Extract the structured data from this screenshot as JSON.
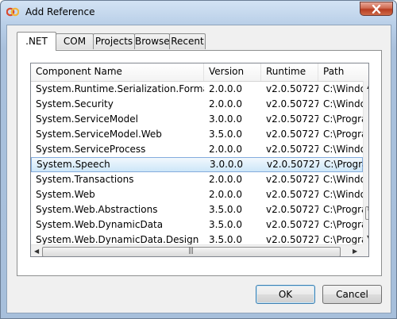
{
  "window": {
    "title": "Add Reference"
  },
  "tabs": [
    ".NET",
    "COM",
    "Projects",
    "Browse",
    "Recent"
  ],
  "columns": [
    "Component Name",
    "Version",
    "Runtime",
    "Path"
  ],
  "rows": [
    {
      "name": "System.Runtime.Serialization.Formatte...",
      "version": "2.0.0.0",
      "runtime": "v2.0.50727",
      "path": "C:\\Window"
    },
    {
      "name": "System.Security",
      "version": "2.0.0.0",
      "runtime": "v2.0.50727",
      "path": "C:\\Window"
    },
    {
      "name": "System.ServiceModel",
      "version": "3.0.0.0",
      "runtime": "v2.0.50727",
      "path": "C:\\Prograr"
    },
    {
      "name": "System.ServiceModel.Web",
      "version": "3.5.0.0",
      "runtime": "v2.0.50727",
      "path": "C:\\Prograr"
    },
    {
      "name": "System.ServiceProcess",
      "version": "2.0.0.0",
      "runtime": "v2.0.50727",
      "path": "C:\\Window"
    },
    {
      "name": "System.Speech",
      "version": "3.0.0.0",
      "runtime": "v2.0.50727",
      "path": "C:\\Prograr"
    },
    {
      "name": "System.Transactions",
      "version": "2.0.0.0",
      "runtime": "v2.0.50727",
      "path": "C:\\Window"
    },
    {
      "name": "System.Web",
      "version": "2.0.0.0",
      "runtime": "v2.0.50727",
      "path": "C:\\Window"
    },
    {
      "name": "System.Web.Abstractions",
      "version": "3.5.0.0",
      "runtime": "v2.0.50727",
      "path": "C:\\Prograr"
    },
    {
      "name": "System.Web.DynamicData",
      "version": "3.5.0.0",
      "runtime": "v2.0.50727",
      "path": "C:\\Prograr"
    },
    {
      "name": "System.Web.DynamicData.Design",
      "version": "3.5.0.0",
      "runtime": "v2.0.50727",
      "path": "C:\\Prograr"
    }
  ],
  "selected_row": 5,
  "buttons": {
    "ok": "OK",
    "cancel": "Cancel"
  },
  "colors": {
    "selection": "#cde6f8",
    "selection_border": "#84acdd",
    "title_gradient": "#b9cfe8",
    "close": "#c4472b"
  }
}
